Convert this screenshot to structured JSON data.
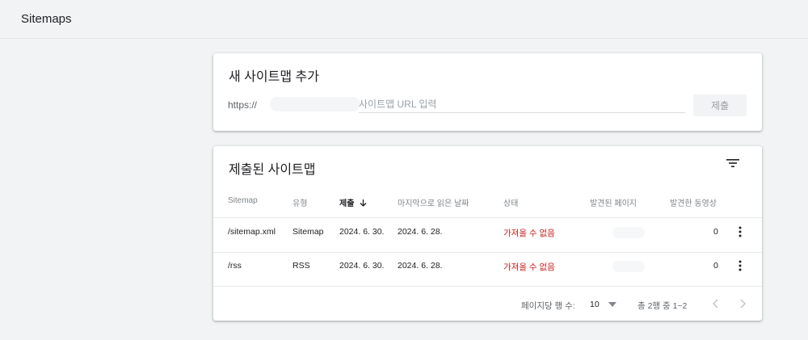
{
  "header": {
    "title": "Sitemaps"
  },
  "add_card": {
    "title": "새 사이트맵 추가",
    "url_prefix": "https://",
    "input_placeholder": "사이트맵 URL 입력",
    "submit_label": "제출"
  },
  "list_card": {
    "title": "제출된 사이트맵",
    "columns": {
      "sitemap": "Sitemap",
      "type": "유형",
      "submitted": "제출",
      "last_read": "마지막으로 읽은 날짜",
      "status": "상태",
      "pages": "발견된 페이지",
      "videos": "발견한 동영상"
    },
    "rows": [
      {
        "sitemap": "/sitemap.xml",
        "type": "Sitemap",
        "submitted": "2024. 6. 30.",
        "last_read": "2024. 6. 28.",
        "status": "가져올 수 없음",
        "videos": "0"
      },
      {
        "sitemap": "/rss",
        "type": "RSS",
        "submitted": "2024. 6. 30.",
        "last_read": "2024. 6. 28.",
        "status": "가져올 수 없음",
        "videos": "0"
      }
    ],
    "footer": {
      "rows_per_page_label": "페이지당 행 수:",
      "rows_per_page_value": "10",
      "range": "총 2행 중 1~2"
    }
  },
  "colors": {
    "error": "#c5221f",
    "muted": "#9aa0a6",
    "background": "#f1f3f4"
  }
}
